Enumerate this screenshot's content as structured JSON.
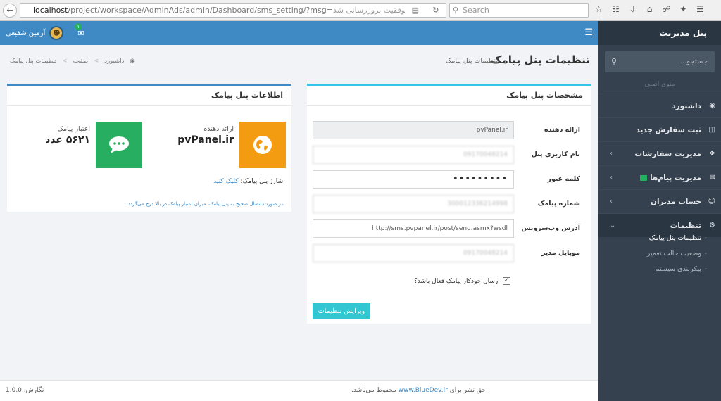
{
  "browser": {
    "url_host": "localhost",
    "url_path": "/project/workspace/AdminAds/admin/Dashboard/sms_setting/?msg=",
    "url_rtl_text": "تنظیمات پنل پیامک با موفقیت بروزرسانی شد",
    "search_placeholder": "Search"
  },
  "sidebar": {
    "brand": "پنل مدیریت",
    "search_placeholder": "جستجو...",
    "section_label": "منوی اصلی",
    "items": [
      {
        "label": "داشبورد",
        "icon": "dashboard-icon"
      },
      {
        "label": "ثبت سفارش جدید",
        "icon": "cart-icon"
      },
      {
        "label": "مدیریت سفارشات",
        "icon": "cubes-icon"
      },
      {
        "label": "مدیریت پیام‌ها",
        "icon": "envelope-icon"
      },
      {
        "label": "حساب مدیران",
        "icon": "user-icon"
      },
      {
        "label": "تنظیمات",
        "icon": "gear-icon"
      }
    ],
    "subitems": [
      {
        "label": "تنظیمات پنل پیامک"
      },
      {
        "label": "وضعیت حالت تعمیر"
      },
      {
        "label": "پیکربندی سیستم"
      }
    ]
  },
  "topbar": {
    "user_name": "آرمین شفیعی",
    "mail_count": "۱"
  },
  "page": {
    "title": "تنظیمات پنل پیامک",
    "subtitle": "تنظیمات پنل پیامک",
    "breadcrumbs": [
      "داشبورد",
      "صفحه",
      "تنظیمات پنل پیامک"
    ]
  },
  "form_panel": {
    "title": "مشخصات پنل پیامک",
    "fields": [
      {
        "label": "ارائه دهنده",
        "value": "pvPanel.ir"
      },
      {
        "label": "نام کاربری پنل",
        "value": "09170048214"
      },
      {
        "label": "کلمه عبور",
        "value": "•••••••••"
      },
      {
        "label": "شماره پیامک",
        "value": "300012336214998"
      },
      {
        "label": "آدرس وب‌سرویس",
        "value": "http://sms.pvpanel.ir/post/send.asmx?wsdl"
      },
      {
        "label": "موبایل مدیر",
        "value": "09170048214"
      }
    ],
    "checkbox_label": "ارسال خودکار پیامک فعال باشد؟",
    "checkbox_checked": true,
    "save_label": "ویرایش تنظیمات"
  },
  "info_panel": {
    "title": "اطلاعات پنل پیامک",
    "provider_caption": "ارائه دهنده",
    "provider_value": "pvPanel.ir",
    "credit_caption": "اعتبار پیامک",
    "credit_value": "۵۶۲۱ عدد",
    "charge_text": "شارژ پنل پیامک:",
    "charge_link": "کلیک کنید",
    "note": "در صورت اتصال صحیح به پنل پیامک، میزان اعتبار پیامک در بالا درج می‌گردد.",
    "colors": {
      "provider": "#f39c12",
      "credit": "#27ae60"
    }
  },
  "footer": {
    "copyright_text": "حق نشر برای",
    "copyright_link": "www.BlueDev.ir",
    "copyright_suffix": "محفوظ می‌باشد.",
    "version": "نگارش، 1.0.0"
  }
}
